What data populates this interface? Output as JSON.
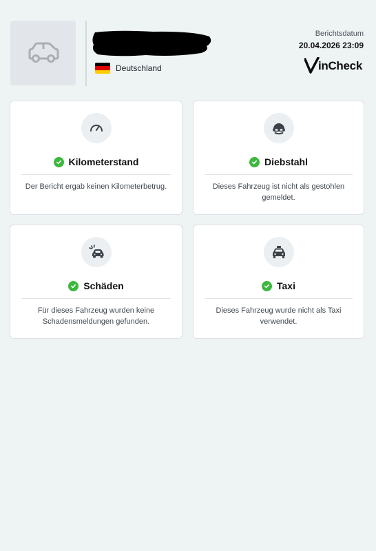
{
  "header": {
    "country": "Deutschland",
    "report_label": "Berichtsdatum",
    "report_date": "20.04.2026 23:09",
    "brand": "inCheck",
    "colors": {
      "flag": [
        "#000000",
        "#dd0000",
        "#ffce00"
      ]
    }
  },
  "cards": [
    {
      "title": "Kilometerstand",
      "icon": "speedometer-icon",
      "description": "Der Bericht ergab keinen Kilometerbetrug."
    },
    {
      "title": "Diebstahl",
      "icon": "thief-mask-icon",
      "description": "Dieses Fahrzeug ist nicht als gestohlen gemeldet."
    },
    {
      "title": "Schäden",
      "icon": "car-crash-icon",
      "description": "Für dieses Fahrzeug wurden keine Schadensmeldungen gefunden."
    },
    {
      "title": "Taxi",
      "icon": "taxi-icon",
      "description": "Dieses Fahrzeug wurde nicht als Taxi verwendet."
    }
  ],
  "colors": {
    "background": "#eef3f4",
    "check": "#3db83f",
    "card": "#ffffff"
  }
}
